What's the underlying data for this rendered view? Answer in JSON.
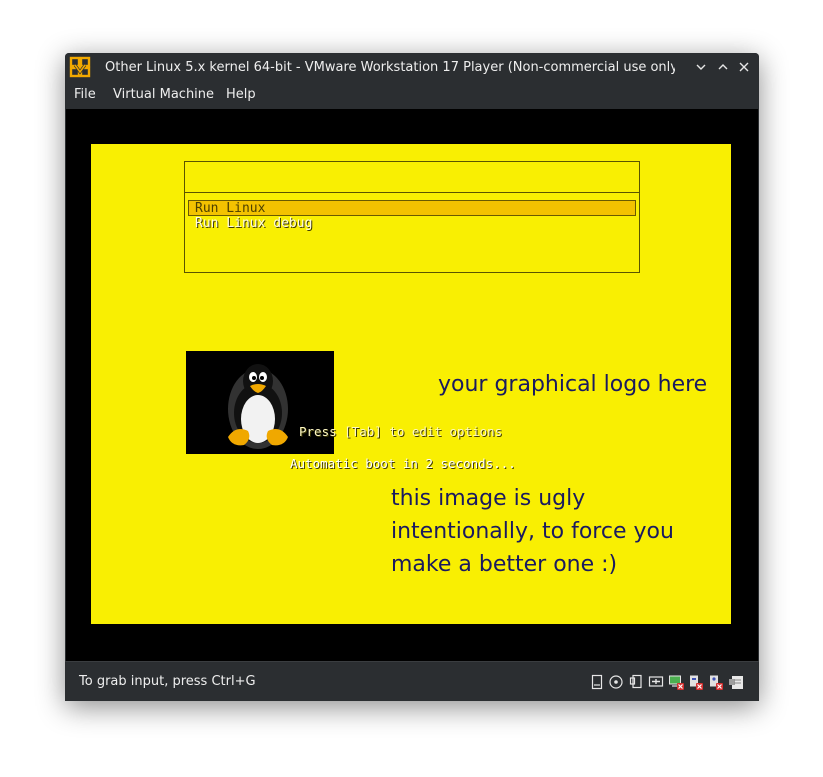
{
  "window": {
    "title": "Other Linux 5.x kernel 64-bit - VMware Workstation 17 Player (Non-commercial use only)",
    "app_icon": "vmware-icon",
    "controls": [
      "minimize-icon",
      "maximize-icon",
      "close-icon"
    ]
  },
  "menubar": {
    "items": [
      "File",
      "Virtual Machine",
      "Help"
    ]
  },
  "boot": {
    "entries": [
      "Run Linux",
      "Run Linux debug"
    ],
    "selected_index": 0,
    "logo_text": "your graphical logo here",
    "press_tab": "Press [Tab] to edit options",
    "autoboot": "Automatic boot in 2 seconds...",
    "ugly_lines": [
      "this image is ugly",
      "intentionally, to force you",
      "make a better one :)"
    ],
    "colors": {
      "background": "#f9ef02",
      "selection": "#f3c200",
      "text": "#1a1a60"
    }
  },
  "status": {
    "text": "To grab input, press Ctrl+G",
    "device_icons": [
      "hard-disk-icon",
      "cd-dvd-icon",
      "usb-device-icon",
      "network-adapter-icon",
      "display-icon",
      "printer-icon",
      "sound-card-icon",
      "message-log-icon"
    ]
  }
}
